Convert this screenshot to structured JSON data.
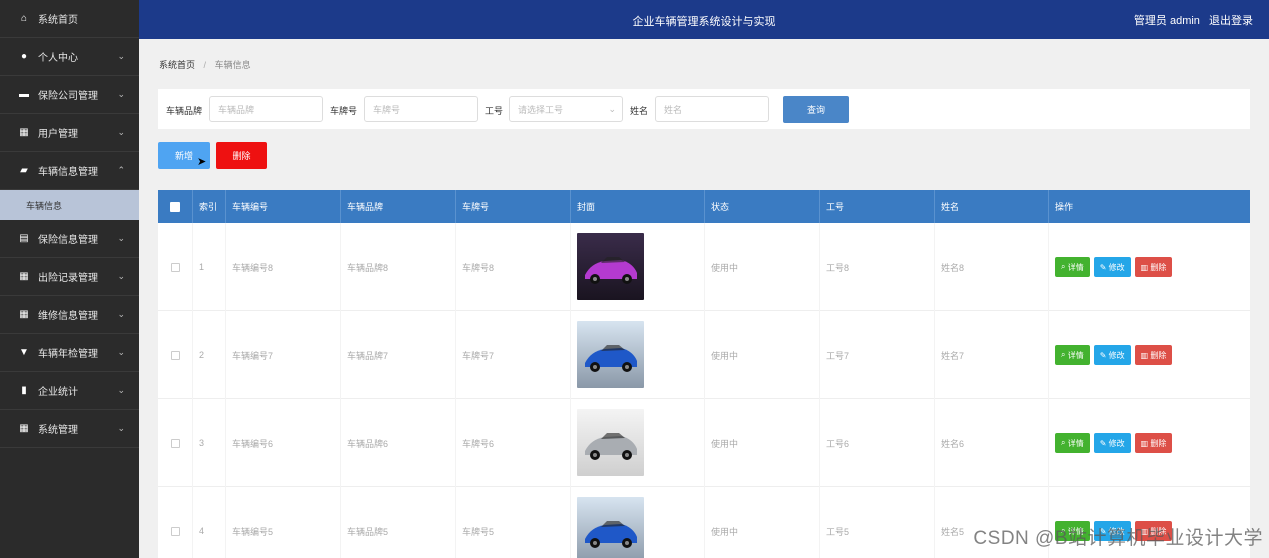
{
  "sidebar": {
    "items": [
      {
        "label": "系统首页",
        "icon": "home-icon",
        "glyph": "⌂",
        "chevron": ""
      },
      {
        "label": "个人中心",
        "icon": "user-icon",
        "glyph": "●",
        "chevron": "⌄"
      },
      {
        "label": "保险公司管理",
        "icon": "monitor-icon",
        "glyph": "▬",
        "chevron": "⌄"
      },
      {
        "label": "用户管理",
        "icon": "grid-icon",
        "glyph": "▦",
        "chevron": "⌄"
      },
      {
        "label": "车辆信息管理",
        "icon": "car-icon",
        "glyph": "▰",
        "chevron": "⌃"
      }
    ],
    "sub_item": "车辆信息",
    "items_after": [
      {
        "label": "保险信息管理",
        "icon": "clipboard-icon",
        "glyph": "▤",
        "chevron": "⌄"
      },
      {
        "label": "出险记录管理",
        "icon": "grid-icon",
        "glyph": "▦",
        "chevron": "⌄"
      },
      {
        "label": "维修信息管理",
        "icon": "grid-icon",
        "glyph": "▦",
        "chevron": "⌄"
      },
      {
        "label": "车辆年检管理",
        "icon": "tag-icon",
        "glyph": "▼",
        "chevron": "⌄"
      },
      {
        "label": "企业统计",
        "icon": "chart-icon",
        "glyph": "▮",
        "chevron": "⌄"
      },
      {
        "label": "系统管理",
        "icon": "grid-icon",
        "glyph": "▦",
        "chevron": "⌄"
      }
    ]
  },
  "header": {
    "title": "企业车辆管理系统设计与实现",
    "role": "管理员 admin",
    "logout": "退出登录"
  },
  "breadcrumb": {
    "home": "系统首页",
    "separator": "/",
    "current": "车辆信息"
  },
  "search": {
    "field1_label": "车辆品牌",
    "field1_placeholder": "车辆品牌",
    "field2_label": "车牌号",
    "field2_placeholder": "车牌号",
    "field3_label": "工号",
    "field3_placeholder": "请选择工号",
    "field4_label": "姓名",
    "field4_placeholder": "姓名",
    "query_label": "查询"
  },
  "actions": {
    "add_label": "新增",
    "delete_label": "删除"
  },
  "table": {
    "columns": [
      "索引",
      "车辆编号",
      "车辆品牌",
      "车牌号",
      "封面",
      "状态",
      "工号",
      "姓名",
      "操作"
    ],
    "rows": [
      {
        "index": "1",
        "vehicle_no": "车辆编号8",
        "brand": "车辆品牌8",
        "plate": "车牌号8",
        "status": "使用中",
        "job_no": "工号8",
        "name": "姓名8",
        "cover": "purple"
      },
      {
        "index": "2",
        "vehicle_no": "车辆编号7",
        "brand": "车辆品牌7",
        "plate": "车牌号7",
        "status": "使用中",
        "job_no": "工号7",
        "name": "姓名7",
        "cover": "blue"
      },
      {
        "index": "3",
        "vehicle_no": "车辆编号6",
        "brand": "车辆品牌6",
        "plate": "车牌号6",
        "status": "使用中",
        "job_no": "工号6",
        "name": "姓名6",
        "cover": "silver"
      },
      {
        "index": "4",
        "vehicle_no": "车辆编号5",
        "brand": "车辆品牌5",
        "plate": "车牌号5",
        "status": "使用中",
        "job_no": "工号5",
        "name": "姓名5",
        "cover": "blue"
      }
    ],
    "row_actions": {
      "detail": "详情",
      "edit": "修改",
      "remove": "删除"
    }
  },
  "watermark": "CSDN @B站计算机毕业设计大学",
  "colors": {
    "header": "#1c3a8a",
    "sidebar": "#2b2b2b",
    "table_head": "#3a7bc2",
    "add": "#4fa4f2",
    "delete": "#ee1111"
  }
}
